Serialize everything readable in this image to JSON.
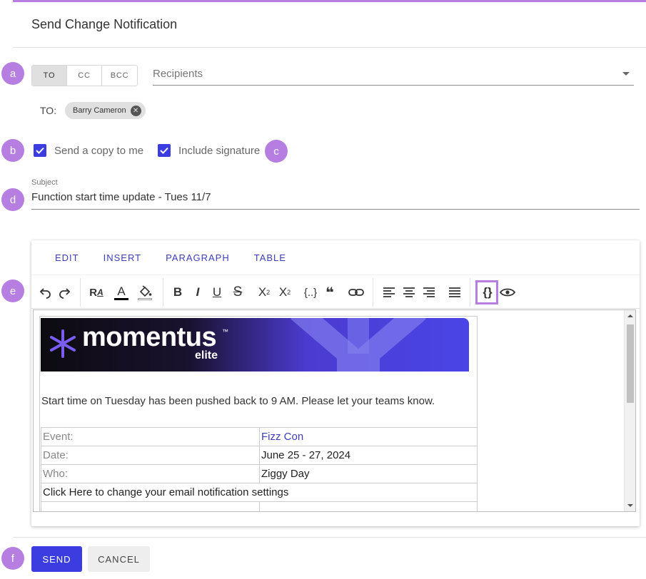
{
  "dialog": {
    "title": "Send Change Notification"
  },
  "badges": {
    "a": "a",
    "b": "b",
    "c": "c",
    "d": "d",
    "e": "e",
    "f": "f"
  },
  "recipient_tabs": [
    {
      "label": "TO",
      "active": true
    },
    {
      "label": "CC"
    },
    {
      "label": "BCC"
    }
  ],
  "recipients": {
    "placeholder": "Recipients"
  },
  "to_row": {
    "label": "TO:",
    "chips": [
      {
        "label": "Barry Cameron"
      }
    ]
  },
  "options": {
    "copy_to_me": "Send a copy to me",
    "include_signature": "Include signature"
  },
  "subject": {
    "label": "Subject",
    "value": "Function start time update - Tues 11/7"
  },
  "editor": {
    "menu": [
      "EDIT",
      "INSERT",
      "PARAGRAPH",
      "TABLE"
    ],
    "toolbar_icons": [
      "undo-icon",
      "redo-icon",
      "font-format-icon",
      "text-color-icon",
      "fill-color-icon",
      "bold-icon",
      "italic-icon",
      "underline-icon",
      "strikethrough-icon",
      "subscript-icon",
      "superscript-icon",
      "insert-variable-icon",
      "blockquote-icon",
      "link-icon",
      "align-left-icon",
      "align-center-icon",
      "align-right-icon",
      "justify-icon",
      "variables-icon",
      "preview-icon"
    ],
    "content": {
      "logo": {
        "word": "momentus",
        "tm": "™",
        "sub": "elite"
      },
      "message": "Start time on Tuesday has been pushed back to 9 AM. Please let your teams know.",
      "rows": [
        {
          "key": "Event:",
          "value": "Fizz Con"
        },
        {
          "key": "Date:",
          "value": "June 25 - 27, 2024"
        },
        {
          "key": "Who:",
          "value": "Ziggy Day"
        }
      ],
      "settings_link": "Click Here to change your email notification settings"
    }
  },
  "actions": {
    "send": "SEND",
    "cancel": "CANCEL"
  },
  "colors": {
    "accent": "#3b3de0",
    "badge": "#b57ee0",
    "menu": "#3e3eb8"
  }
}
